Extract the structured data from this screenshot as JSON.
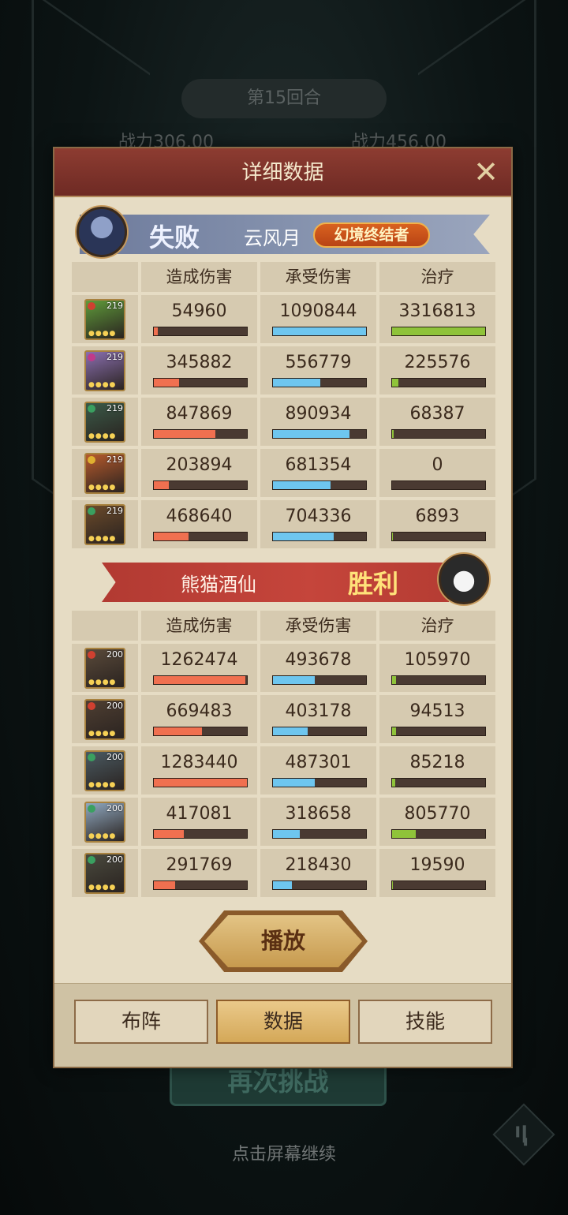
{
  "background": {
    "round_label": "第15回合",
    "left_power": "战力306.00",
    "right_power": "战力456.00",
    "retry_label": "再次挑战",
    "continue_hint": "点击屏幕继续"
  },
  "dialog": {
    "title": "详细数据",
    "close_icon": "close-x-icon"
  },
  "teams": [
    {
      "result": "失败",
      "player_name": "云风月",
      "title_badge": "幻境终结者",
      "columns": [
        "造成伤害",
        "承受伤害",
        "治疗"
      ],
      "heroes": [
        {
          "level": "219",
          "damage": "54960",
          "taken": "1090844",
          "heal": "3316813",
          "damage_ratio": 0.04,
          "taken_ratio": 1.0,
          "heal_ratio": 1.0,
          "color": "#5f9b3a",
          "dot": "#d04030"
        },
        {
          "level": "219",
          "damage": "345882",
          "taken": "556779",
          "heal": "225576",
          "damage_ratio": 0.27,
          "taken_ratio": 0.51,
          "heal_ratio": 0.07,
          "color": "#8a6fb0",
          "dot": "#c03a8a"
        },
        {
          "level": "219",
          "damage": "847869",
          "taken": "890934",
          "heal": "68387",
          "damage_ratio": 0.66,
          "taken_ratio": 0.82,
          "heal_ratio": 0.02,
          "color": "#3a5a48",
          "dot": "#3aa060"
        },
        {
          "level": "219",
          "damage": "203894",
          "taken": "681354",
          "heal": "0",
          "damage_ratio": 0.16,
          "taken_ratio": 0.62,
          "heal_ratio": 0.0,
          "color": "#b65a2c",
          "dot": "#e0b030"
        },
        {
          "level": "219",
          "damage": "468640",
          "taken": "704336",
          "heal": "6893",
          "damage_ratio": 0.37,
          "taken_ratio": 0.65,
          "heal_ratio": 0.01,
          "color": "#6b4a2a",
          "dot": "#3aa060"
        }
      ]
    },
    {
      "result": "胜利",
      "player_name": "熊猫酒仙",
      "columns": [
        "造成伤害",
        "承受伤害",
        "治疗"
      ],
      "heroes": [
        {
          "level": "200",
          "damage": "1262474",
          "taken": "493678",
          "heal": "105970",
          "damage_ratio": 0.98,
          "taken_ratio": 0.45,
          "heal_ratio": 0.04,
          "color": "#5a4a3a",
          "dot": "#d04030"
        },
        {
          "level": "200",
          "damage": "669483",
          "taken": "403178",
          "heal": "94513",
          "damage_ratio": 0.52,
          "taken_ratio": 0.37,
          "heal_ratio": 0.04,
          "color": "#4f3f32",
          "dot": "#d04030"
        },
        {
          "level": "200",
          "damage": "1283440",
          "taken": "487301",
          "heal": "85218",
          "damage_ratio": 1.0,
          "taken_ratio": 0.45,
          "heal_ratio": 0.03,
          "color": "#4a5a62",
          "dot": "#3aa060"
        },
        {
          "level": "200",
          "damage": "417081",
          "taken": "318658",
          "heal": "805770",
          "damage_ratio": 0.32,
          "taken_ratio": 0.29,
          "heal_ratio": 0.25,
          "color": "#8fa8c0",
          "dot": "#3aa060"
        },
        {
          "level": "200",
          "damage": "291769",
          "taken": "218430",
          "heal": "19590",
          "damage_ratio": 0.23,
          "taken_ratio": 0.2,
          "heal_ratio": 0.01,
          "color": "#4a4a3e",
          "dot": "#3aa060"
        }
      ]
    }
  ],
  "play_button": "播放",
  "tabs": [
    "布阵",
    "数据",
    "技能"
  ],
  "active_tab": "数据"
}
